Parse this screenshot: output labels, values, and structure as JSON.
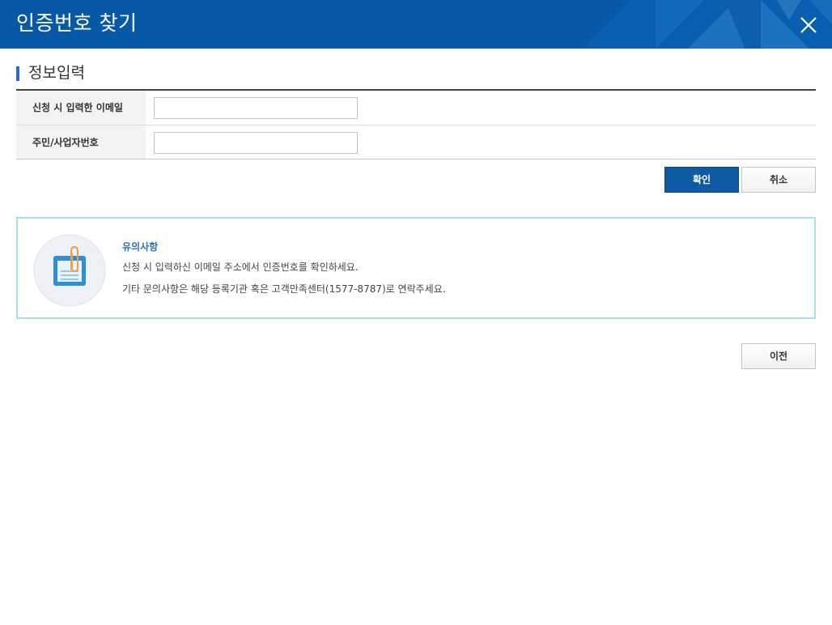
{
  "header": {
    "title": "인증번호 찾기"
  },
  "section": {
    "title": "정보입력"
  },
  "form": {
    "rows": [
      {
        "label": "신청 시 입력한 이메일",
        "value": "",
        "placeholder": ""
      },
      {
        "label": "주민/사업자번호",
        "value": "",
        "placeholder": ""
      }
    ]
  },
  "actions": {
    "confirm_label": "확인",
    "cancel_label": "취소"
  },
  "notice": {
    "title": "유의사항",
    "lines": [
      "신청 시 입력하신 이메일 주소에서 인증번호를 확인하세요.",
      "기타 문의사항은 해당 등록기관 혹은 고객만족센터(1577-8787)로 연락주세요."
    ]
  },
  "footer": {
    "prev_label": "이전"
  },
  "colors": {
    "header_bg": "#0759a8",
    "accent": "#2f6fb9",
    "primary_button": "#0f5aa5",
    "notice_border": "#a6e3ea"
  },
  "icons": {
    "close": "close-icon",
    "notice": "clipboard-note-icon"
  }
}
